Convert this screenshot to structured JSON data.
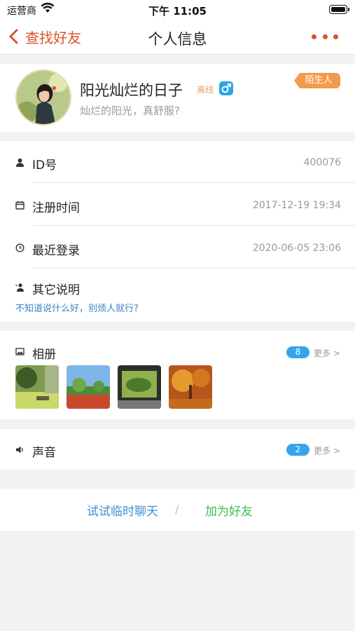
{
  "statusbar": {
    "carrier": "运营商",
    "time": "下午 11:05"
  },
  "nav": {
    "back_label": "查找好友",
    "title": "个人信息"
  },
  "profile": {
    "name": "阳光灿烂的日子",
    "status": "离线",
    "gender": "male",
    "signature": "灿烂的阳光，真舒服?",
    "tag": "陌生人"
  },
  "info": {
    "id_label": "ID号",
    "id_value": "400076",
    "register_label": "注册时间",
    "register_value": "2017-12-19 19:34",
    "login_label": "最近登录",
    "login_value": "2020-06-05 23:06",
    "note_label": "其它说明",
    "note_value": "不知道说什么好，别烦人就行?"
  },
  "album": {
    "label": "相册",
    "count": "8",
    "more": "更多 >"
  },
  "voice": {
    "label": "声音",
    "count": "2",
    "more": "更多 >"
  },
  "actions": {
    "chat": "试试临时聊天",
    "separator": "/",
    "add": "加为好友"
  },
  "colors": {
    "accent": "#d9532c",
    "link_blue": "#3b8fd6",
    "add_green": "#3cbf4a",
    "badge_blue": "#36a3ee",
    "tag_orange": "#f29c4b"
  }
}
